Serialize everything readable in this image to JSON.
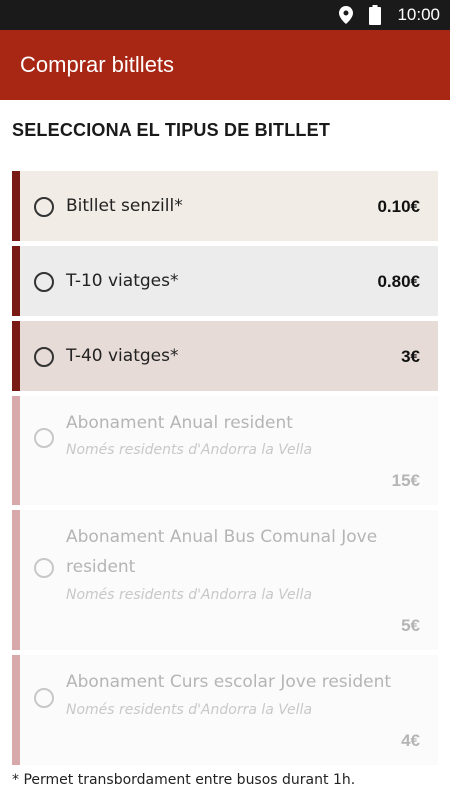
{
  "status_bar": {
    "time": "10:00",
    "icons": [
      "location-icon",
      "battery-icon"
    ]
  },
  "app_bar": {
    "title": "Comprar bitllets",
    "color": "#a82614"
  },
  "section_title": "SELECCIONA EL TIPUS DE BITLLET",
  "tickets": [
    {
      "name": "Bitllet senzill*",
      "subtitle": "",
      "price": "0.10€",
      "enabled": true,
      "accent": "#7a1a14",
      "background": "#f1ede6"
    },
    {
      "name": "T-10 viatges*",
      "subtitle": "",
      "price": "0.80€",
      "enabled": true,
      "accent": "#7a1a14",
      "background": "#ececec"
    },
    {
      "name": "T-40 viatges*",
      "subtitle": "",
      "price": "3€",
      "enabled": true,
      "accent": "#7a1a14",
      "background": "#e6dbd6"
    },
    {
      "name": "Abonament Anual resident",
      "subtitle": "Només residents d'Andorra la Vella",
      "price": "15€",
      "enabled": false,
      "accent": "#d7a9ab",
      "background": "#fbfbfb"
    },
    {
      "name": "Abonament Anual Bus Comunal Jove resident",
      "subtitle": "Només residents d'Andorra la Vella",
      "price": "5€",
      "enabled": false,
      "accent": "#d7a9ab",
      "background": "#fbfbfb"
    },
    {
      "name": "Abonament Curs escolar Jove resident",
      "subtitle": "Només residents d'Andorra la Vella",
      "price": "4€",
      "enabled": false,
      "accent": "#d7a9ab",
      "background": "#fbfbfb"
    }
  ],
  "footnote": "* Permet transbordament entre busos durant 1h."
}
